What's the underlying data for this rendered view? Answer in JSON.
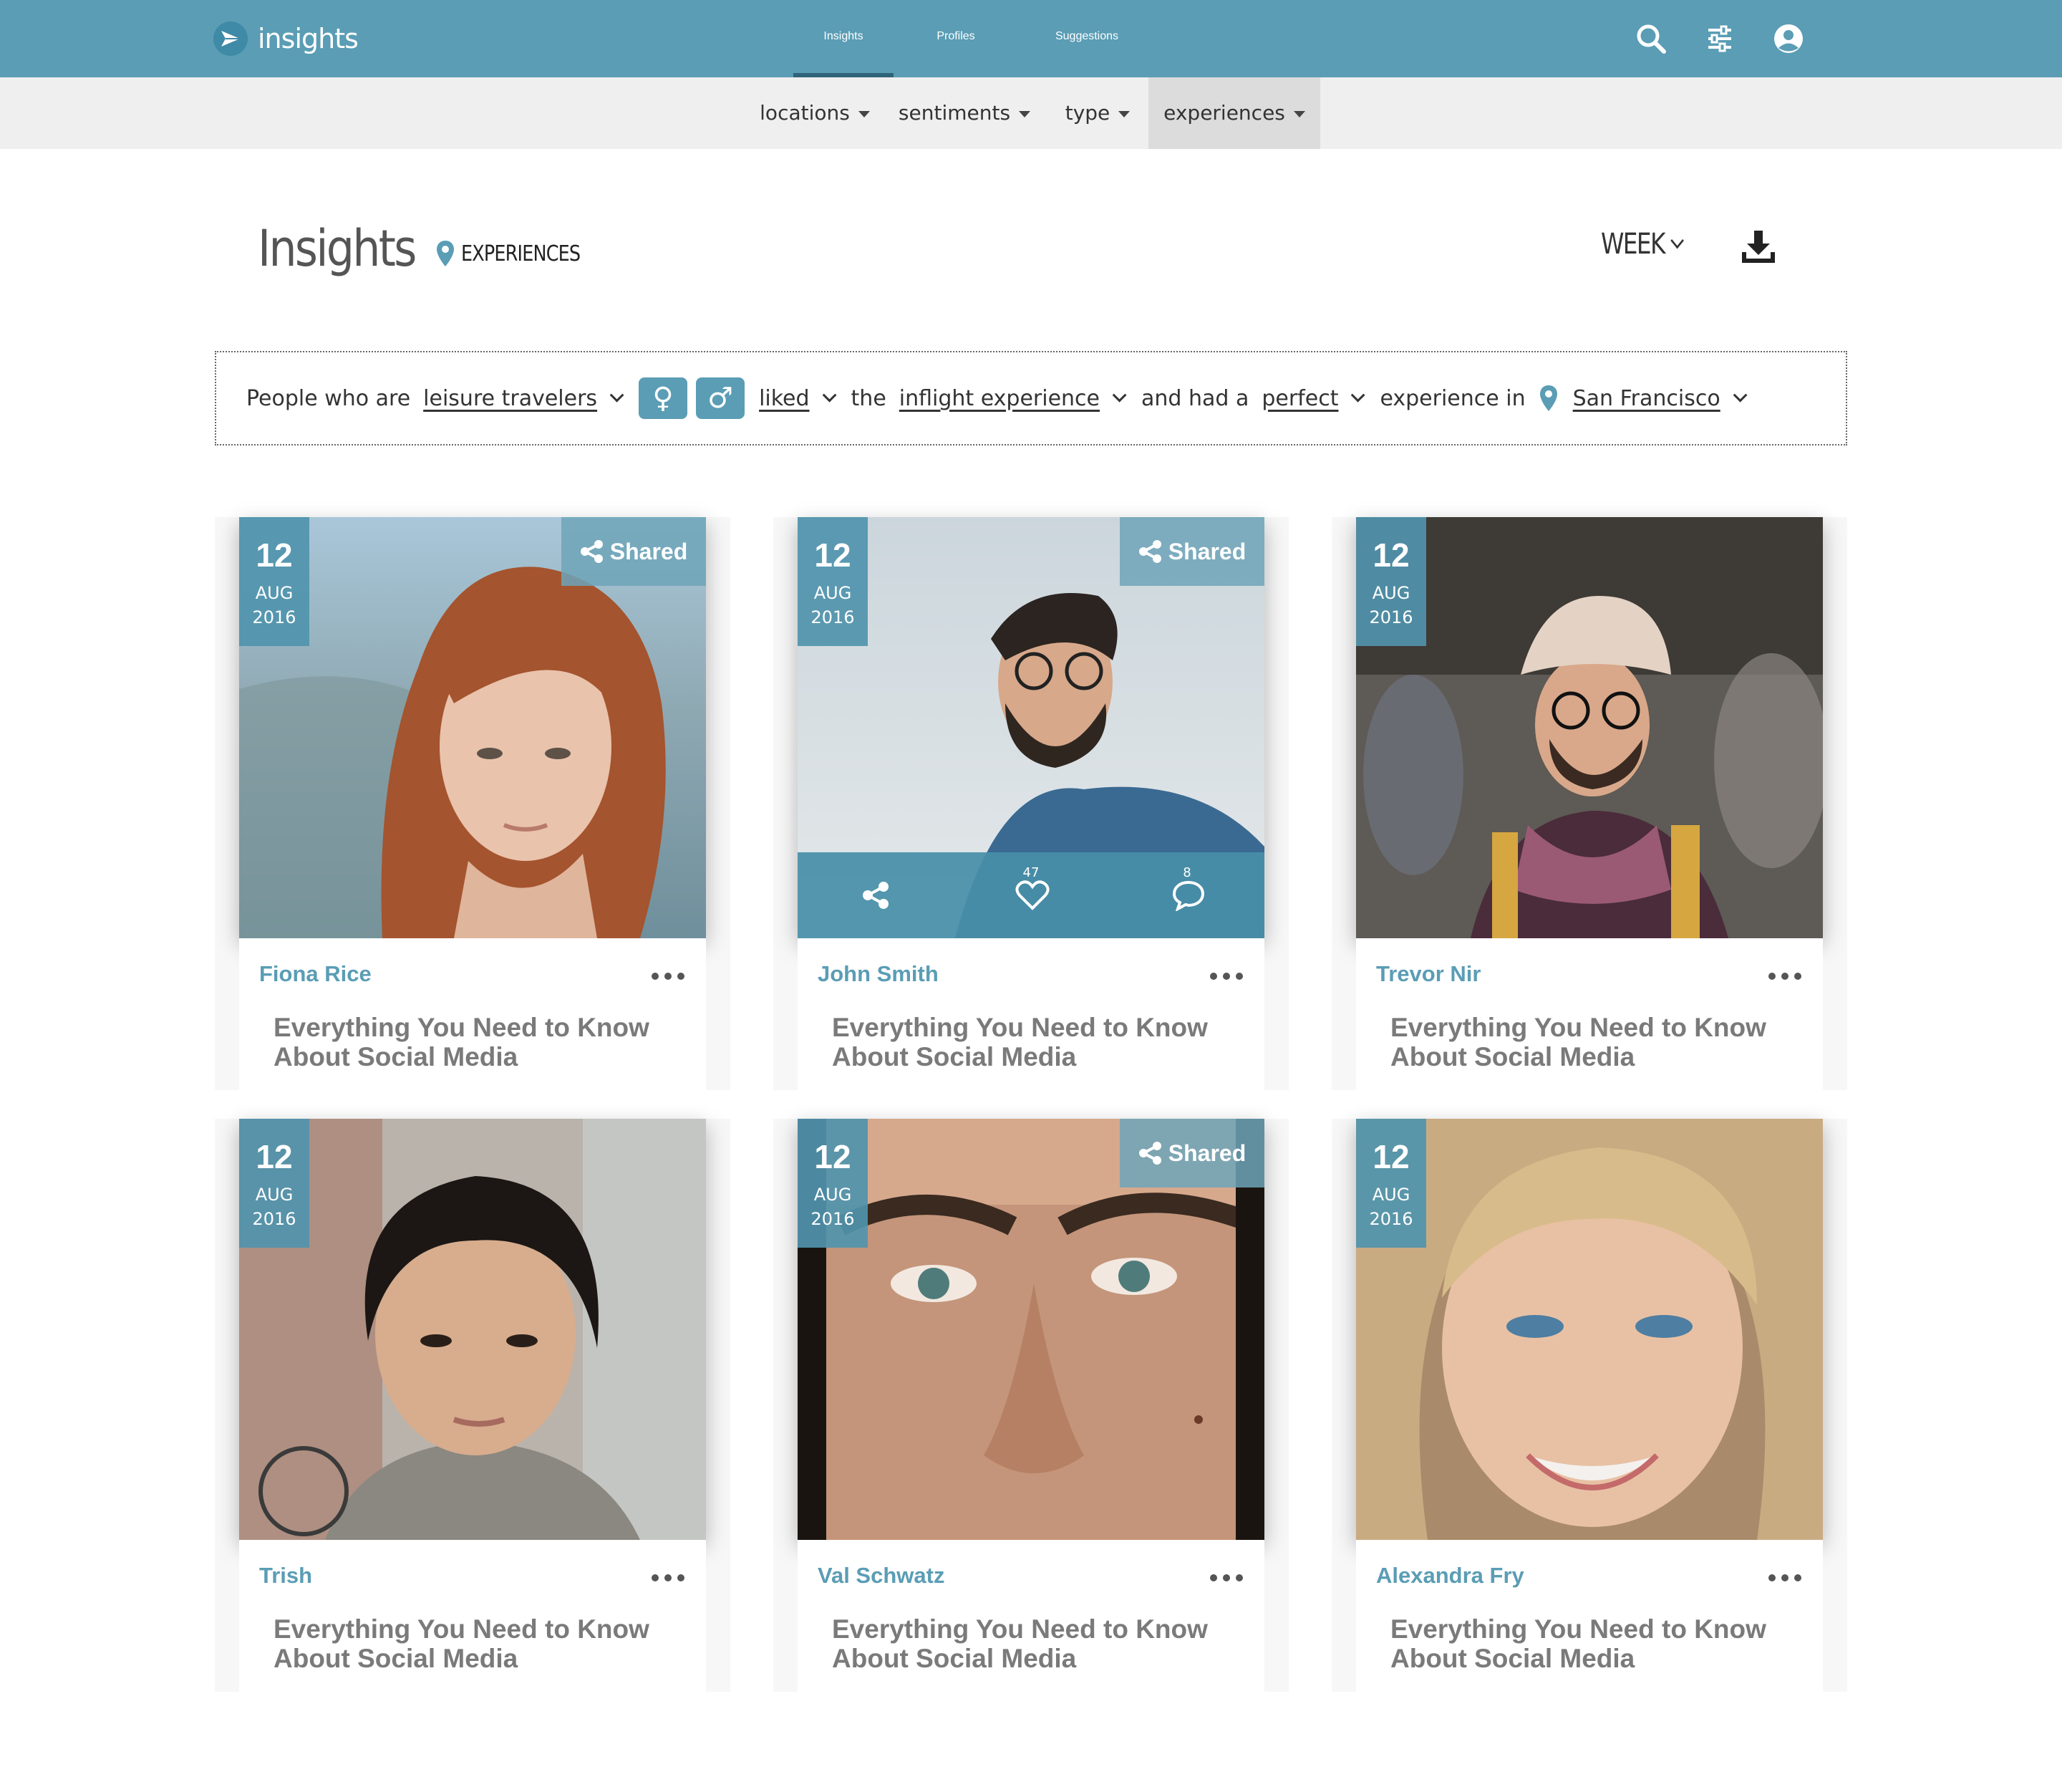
{
  "app": {
    "name": "insights"
  },
  "nav": {
    "items": [
      {
        "label": "Insights",
        "active": true
      },
      {
        "label": "Profiles"
      },
      {
        "label": "Suggestions"
      }
    ]
  },
  "top_icons": [
    "search-icon",
    "sliders-icon",
    "user-icon"
  ],
  "filters": {
    "items": [
      {
        "label": "locations"
      },
      {
        "label": "sentiments"
      },
      {
        "label": "type"
      },
      {
        "label": "experiences",
        "active": true
      }
    ]
  },
  "page": {
    "title": "Insights",
    "breadcrumb": "EXPERIENCES",
    "period": "WEEK"
  },
  "sentence": {
    "w1": "People who are",
    "traveler_type": "leisure travelers",
    "female_symbol": "♀",
    "male_symbol": "♂",
    "verb": "liked",
    "w2": "the",
    "subject": "inflight experience",
    "w3": "and had a",
    "rating": "perfect",
    "w4": "experience in",
    "location": "San Francisco"
  },
  "cards": [
    {
      "day": "12",
      "month": "AUG",
      "year": "2016",
      "shared_label": "Shared",
      "name": "Fiona Rice",
      "title": "Everything You Need to Know About Social Media"
    },
    {
      "day": "12",
      "month": "AUG",
      "year": "2016",
      "shared_label": "Shared",
      "name": "John Smith",
      "title": "Everything You Need to Know About Social Media",
      "likes": "47",
      "comments": "8"
    },
    {
      "day": "12",
      "month": "AUG",
      "year": "2016",
      "name": "Trevor Nir",
      "title": "Everything You Need to Know About Social Media"
    },
    {
      "day": "12",
      "month": "AUG",
      "year": "2016",
      "name": "Trish",
      "title": "Everything You Need to Know About Social Media"
    },
    {
      "day": "12",
      "month": "AUG",
      "year": "2016",
      "shared_label": "Shared",
      "name": "Val Schwatz",
      "title": "Everything You Need to Know About Social Media"
    },
    {
      "day": "12",
      "month": "AUG",
      "year": "2016",
      "name": "Alexandra Fry",
      "title": "Everything You Need to Know About Social Media"
    }
  ],
  "colors": {
    "brand": "#5a9db5",
    "card_title": "#7a7a7a"
  }
}
